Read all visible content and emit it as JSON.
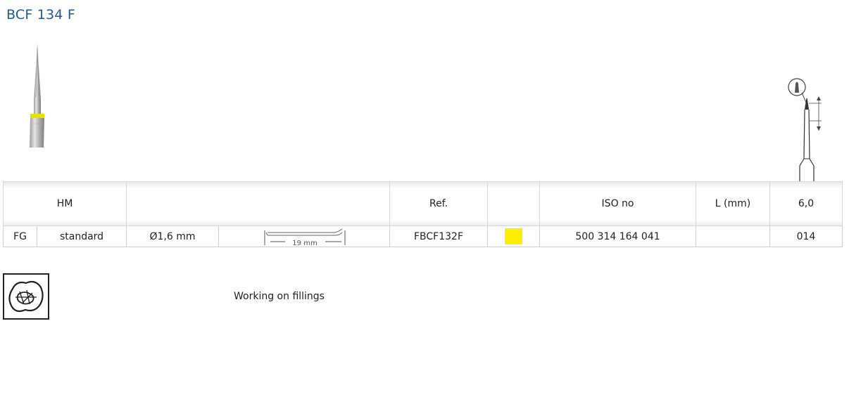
{
  "product": {
    "title": "BCF 134 F"
  },
  "table": {
    "header": {
      "material": "HM",
      "ref_label": "Ref.",
      "iso_label": "ISO no",
      "length_label": "L (mm)",
      "length_value": "6,0"
    },
    "row": {
      "shank": "FG",
      "type": "standard",
      "diameter": "Ø1,6 mm",
      "shank_length": "19 mm",
      "ref": "FBCF132F",
      "color_code": "#ffee00",
      "iso": "500 314 164 041",
      "size": "014"
    }
  },
  "indication": {
    "icon": "tooth-filling-icon",
    "text": "Working on fillings"
  }
}
